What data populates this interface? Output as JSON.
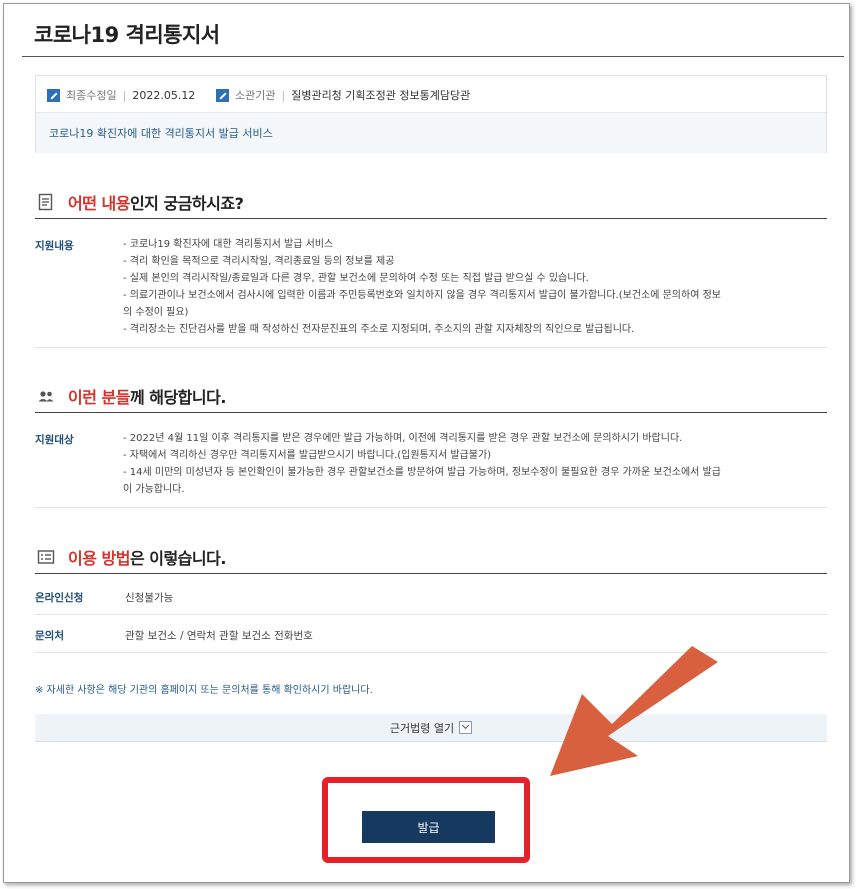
{
  "page_title": "코로나19 격리통지서",
  "meta": {
    "modified_label": "최종수정일",
    "modified_value": "2022.05.12",
    "agency_label": "소관기관",
    "agency_value": "질병관리청 기획조정관 정보통계담당관",
    "description": "코로나19 확진자에 대한 격리통지서 발급 서비스"
  },
  "sections": {
    "what": {
      "title_hl": "어떤 내용",
      "title_rest": "인지 궁금하시죠?",
      "label": "지원내용",
      "lines": [
        "- 코로나19 확진자에 대한 격리통지서 발급 서비스",
        "- 격리 확인을 목적으로 격리시작일, 격리종료일 등의 정보를 제공",
        "- 실제 본인의 격리시작일/종료일과 다른 경우, 관할 보건소에 문의하여 수정 또는 직접 발급 받으실 수 있습니다.",
        "- 의료기관이나 보건소에서 검사시에 입력한 이름과 주민등록번호와 일치하지 않을 경우 격리통지서 발급이 불가합니다.(보건소에 문의하여 정보",
        "의 수정이 필요)",
        "- 격리장소는 진단검사를 받을 때 작성하신 전자문진표의 주소로 지정되며, 주소지의 관할 지자체장의 직인으로 발급됩니다."
      ]
    },
    "who": {
      "title_hl": "이런 분들",
      "title_rest": "께 해당합니다.",
      "label": "지원대상",
      "lines": [
        "- 2022년 4월 11일 이후 격리통지를 받은 경우에만 발급 가능하며, 이전에 격리통지를 받은 경우 관할 보건소에 문의하시기 바랍니다.",
        "- 자택에서 격리하신 경우만 격리통지서를 발급받으시기 바랍니다.(입원통지서 발급불가)",
        "- 14세 미만의 미성년자 등 본인확인이 불가능한 경우 관할보건소를 방문하여 발급 가능하며, 정보수정이 불필요한 경우 가까운 보건소에서 발급",
        "이 가능합니다."
      ]
    },
    "how": {
      "title_hl": "이용 방법",
      "title_rest": "은 이렇습니다.",
      "rows": [
        {
          "label": "온라인신청",
          "value": "신청불가능"
        },
        {
          "label": "문의처",
          "value": "관할 보건소 / 연락처 관할 보건소 전화번호"
        }
      ]
    }
  },
  "notice": "※ 자세한 사항은 해당 기관의 홈페이지 또는 문의처를 통해 확인하시기 바랍니다.",
  "law_toggle_label": "근거법령 열기",
  "issue_button_label": "발급",
  "colors": {
    "accent_red": "#d7322d",
    "navy": "#163a5f",
    "label_blue": "#1f4e78",
    "arrow_orange": "#d9603e",
    "highlight_box": "#e8202a"
  }
}
